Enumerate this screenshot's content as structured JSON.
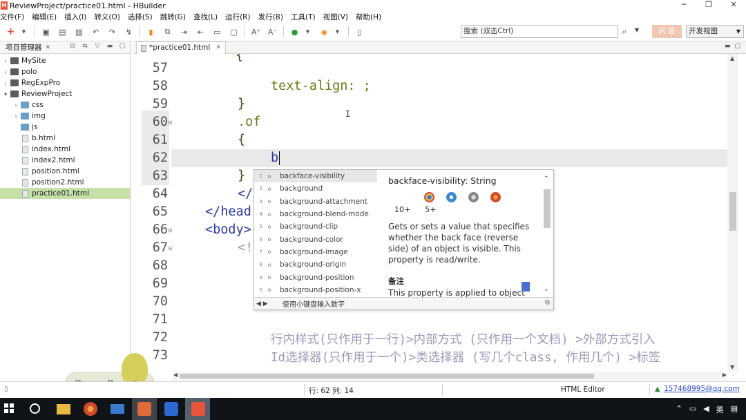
{
  "window": {
    "title": "ReviewProject/practice01.html - HBuilder",
    "controls": [
      "─",
      "❐",
      "✕"
    ]
  },
  "menu": [
    "文件(F)",
    "编辑(E)",
    "插入(I)",
    "转义(O)",
    "选择(S)",
    "跳转(G)",
    "查找(L)",
    "运行(R)",
    "发行(B)",
    "工具(T)",
    "视图(V)",
    "帮助(H)"
  ],
  "toolbar": {
    "search_placeholder": "搜索 (双击Ctrl)",
    "qa_label": "问 答",
    "view_mode": "开发视图"
  },
  "project_panel": {
    "title": "项目管理器",
    "tree": [
      {
        "label": "MySite",
        "depth": 0,
        "type": "project",
        "expanded": false
      },
      {
        "label": "polo",
        "depth": 0,
        "type": "project",
        "expanded": false
      },
      {
        "label": "RegExpPro",
        "depth": 0,
        "type": "project",
        "expanded": false
      },
      {
        "label": "ReviewProject",
        "depth": 0,
        "type": "project",
        "expanded": true
      },
      {
        "label": "css",
        "depth": 1,
        "type": "folder",
        "expanded": false
      },
      {
        "label": "img",
        "depth": 1,
        "type": "folder",
        "expanded": false
      },
      {
        "label": "js",
        "depth": 1,
        "type": "folder",
        "expanded": null
      },
      {
        "label": "b.html",
        "depth": 1,
        "type": "file"
      },
      {
        "label": "index.html",
        "depth": 1,
        "type": "file"
      },
      {
        "label": "index2.html",
        "depth": 1,
        "type": "file"
      },
      {
        "label": "position.html",
        "depth": 1,
        "type": "file"
      },
      {
        "label": "position2.html",
        "depth": 1,
        "type": "file"
      },
      {
        "label": "practice01.html",
        "depth": 1,
        "type": "file",
        "selected": true
      }
    ]
  },
  "editor": {
    "tab_label": "*practice01.html",
    "lines": [
      57,
      58,
      59,
      60,
      61,
      62,
      63,
      64,
      65,
      66,
      67,
      68,
      69,
      70,
      71,
      72,
      73
    ],
    "code": {
      "l58": "text-align: ;",
      "l59": "}",
      "l60": ".of",
      "l61": "{",
      "l62": "b",
      "l63": "}",
      "l64": "</",
      "l65": "</head",
      "l66": "<body>",
      "l67": "<!",
      "l72": "行内样式(只作用于一行)>内部方式 (只作用一个文档) >外部方式引入",
      "l73": "Id选择器(只作用于一个)>类选择器 (写几个class, 作用几个) >标签"
    }
  },
  "autocomplete": {
    "items": [
      "backface-visibility",
      "background",
      "background-attachment",
      "background-blend-mode",
      "background-clip",
      "background-color",
      "background-image",
      "background-origin",
      "background-position",
      "background-position-x"
    ],
    "item_numbers": [
      "1",
      "2",
      "3",
      "4",
      "5",
      "6",
      "7",
      "8",
      "9",
      "0"
    ],
    "selected_index": 0,
    "doc_title": "backface-visibility: String",
    "browser_versions": [
      "10+",
      "5+"
    ],
    "description": "Gets or sets a value that specifies whether the back face (reverse side) of an object is visible. This property is read/write.",
    "note_title": "备注",
    "note_text": "This property is applied to object",
    "footer_hint": "使用小键盘输入数字"
  },
  "ime": {
    "lang": "英",
    "icons": [
      "·,",
      "♥"
    ]
  },
  "status": {
    "left_icon": "▯",
    "position": "行: 62 列: 14",
    "editor_type": "HTML Editor",
    "user": "157468995@qq.com"
  },
  "colors": {
    "selected_tree_bg": "#c6e0a8",
    "property_color": "#6e7a15",
    "tag_color": "#2a3aa0"
  }
}
